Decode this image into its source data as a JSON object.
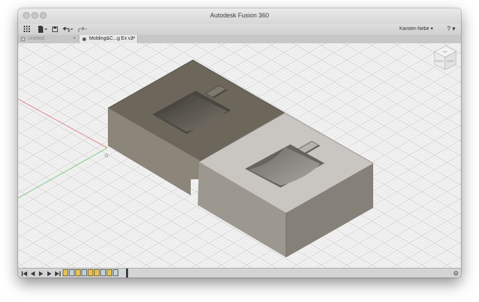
{
  "window": {
    "title": "Autodesk Fusion 360"
  },
  "toolbar": {
    "user_menu_label": "Karsten Nebe ▾",
    "help_label": "? ▾",
    "icons": [
      "app-grid-icon",
      "file-menu-icon",
      "save-icon",
      "undo-icon",
      "redo-icon"
    ]
  },
  "tabs": [
    {
      "label": "Untitled",
      "close": "×",
      "active": false
    },
    {
      "label": "Molding&C...g Ex v2*",
      "close": "×",
      "active": true
    }
  ],
  "viewcube": {
    "faces": [
      "TOP",
      "FRONT",
      "RIGHT"
    ]
  },
  "timeline": {
    "controls": [
      "skip-to-start-icon",
      "step-back-icon",
      "play-icon",
      "step-forward-icon",
      "skip-to-end-icon"
    ],
    "features": [
      "sketch",
      "extrude",
      "sketch",
      "extrude",
      "combine",
      "sketch",
      "extrude",
      "sketch",
      "extrude"
    ]
  },
  "colors": {
    "viewport_bg": "#f1f1f1",
    "dark_mold_top": "#6c665b",
    "light_mold_top": "#c9c6c1"
  }
}
